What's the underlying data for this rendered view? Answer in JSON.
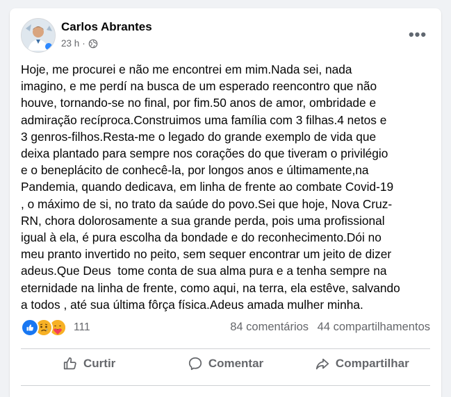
{
  "post": {
    "author": "Carlos Abrantes",
    "time": "23 h",
    "separator": "·",
    "text": "Hoje, me procurei e não me encontrei em mim.Nada sei, nada\nimagino, e me perdí na busca de um esperado reencontro que não\nhouve, tornando-se no final, por fim.50 anos de amor, ombridade e\nadmiração recíproca.Construimos uma família com 3 filhas.4 netos e\n3 genros-filhos.Resta-me o legado do grande exemplo de vida que\ndeixa plantado para sempre nos corações do que tiveram o privilégio\ne o beneplácito de conhecê-la, por longos anos e últimamente,na\nPandemia, quando dedicava, em linha de frente ao combate Covid-19\n, o máximo de si, no trato da saúde do povo.Sei que hoje, Nova Cruz-\nRN, chora dolorosamente a sua grande perda, pois uma profissional\nigual à ela, é pura escolha da bondade e do reconhecimento.Dói no\nmeu pranto invertido no peito, sem sequer encontrar um jeito de dizer\nadeus.Que Deus  tome conta de sua alma pura e a tenha sempre na\neternidade na linha de frente, como aqui, na terra, ela estêve, salvando\na todos , até sua última fôrça física.Adeus amada mulher minha.",
    "audience_icon": "globe-icon",
    "more_icon": "more-options-icon",
    "more_label": "•••"
  },
  "stats": {
    "reaction_icons": [
      "like-reaction-icon",
      "sad-reaction-icon",
      "care-reaction-icon"
    ],
    "reaction_count": "111",
    "comments": "84 comentários",
    "shares": "44 compartilhamentos"
  },
  "actions": {
    "like": "Curtir",
    "comment": "Comentar",
    "share": "Compartilhar"
  },
  "colors": {
    "brand_blue": "#1877f2",
    "secondary_text": "#65676b",
    "primary_text": "#050505",
    "background": "#f0f2f5",
    "reaction_yellow": "#f7b125"
  }
}
